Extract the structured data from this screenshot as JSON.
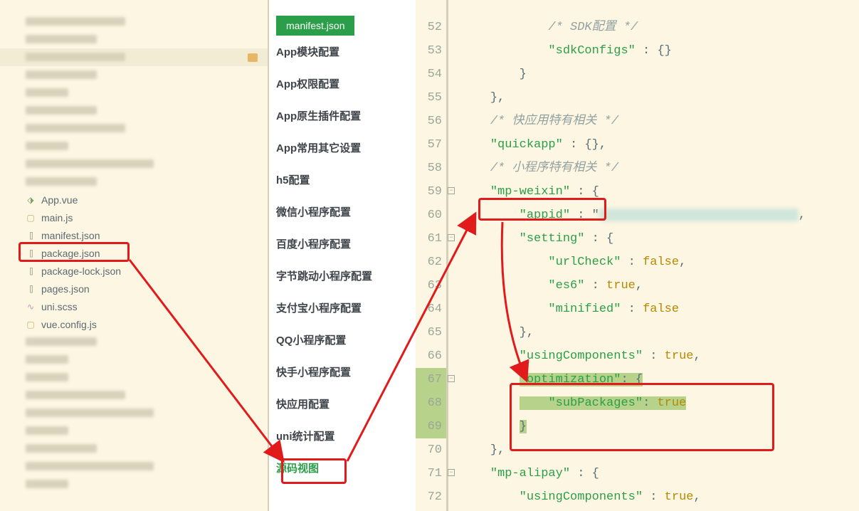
{
  "sidebar": {
    "files": [
      {
        "type": "blur",
        "name": "",
        "w": "w140"
      },
      {
        "type": "blur",
        "name": "",
        "w": "w100"
      },
      {
        "type": "blur",
        "name": "",
        "w": "w140",
        "folder": true
      },
      {
        "type": "blur",
        "name": "",
        "w": "w100"
      },
      {
        "type": "blur",
        "name": "",
        "w": "w60"
      },
      {
        "type": "blur",
        "name": "",
        "w": "w100"
      },
      {
        "type": "blur",
        "name": "",
        "w": "w140"
      },
      {
        "type": "blur",
        "name": "",
        "w": "w60"
      },
      {
        "type": "blur",
        "name": "",
        "w": "w180"
      },
      {
        "type": "blur",
        "name": "",
        "w": "w100"
      },
      {
        "type": "file",
        "name": "App.vue",
        "icon": "vue"
      },
      {
        "type": "file",
        "name": "main.js",
        "icon": "js"
      },
      {
        "type": "file",
        "name": "manifest.json",
        "icon": "json",
        "highlight": true
      },
      {
        "type": "file",
        "name": "package.json",
        "icon": "json"
      },
      {
        "type": "file",
        "name": "package-lock.json",
        "icon": "json"
      },
      {
        "type": "file",
        "name": "pages.json",
        "icon": "json"
      },
      {
        "type": "file",
        "name": "uni.scss",
        "icon": "scss"
      },
      {
        "type": "file",
        "name": "vue.config.js",
        "icon": "js"
      },
      {
        "type": "blur",
        "name": "",
        "w": "w100"
      },
      {
        "type": "blur",
        "name": "",
        "w": "w60"
      },
      {
        "type": "blur",
        "name": "",
        "w": "w60"
      },
      {
        "type": "blur",
        "name": "",
        "w": "w140"
      },
      {
        "type": "blur",
        "name": "",
        "w": "w180"
      },
      {
        "type": "blur",
        "name": "",
        "w": "w60"
      },
      {
        "type": "blur",
        "name": "",
        "w": "w100"
      },
      {
        "type": "blur",
        "name": "",
        "w": "w180"
      },
      {
        "type": "blur",
        "name": "",
        "w": "w60"
      }
    ]
  },
  "confignav": {
    "tab": "manifest.json",
    "items": [
      "App模块配置",
      "App权限配置",
      "App原生插件配置",
      "App常用其它设置",
      "h5配置",
      "微信小程序配置",
      "百度小程序配置",
      "字节跳动小程序配置",
      "支付宝小程序配置",
      "QQ小程序配置",
      "快手小程序配置",
      "快应用配置",
      "uni统计配置",
      "源码视图"
    ],
    "activeIndex": 13
  },
  "code": {
    "startLine": 52,
    "lines": [
      {
        "n": 52,
        "html": "            <span class='c'>/* SDK配置 */</span>"
      },
      {
        "n": 53,
        "html": "            <span class='s'>\"sdkConfigs\"</span> <span class='p'>: {}</span>"
      },
      {
        "n": 54,
        "html": "        <span class='p'>}</span>"
      },
      {
        "n": 55,
        "html": "    <span class='p'>},</span>"
      },
      {
        "n": 56,
        "html": "    <span class='c'>/* 快应用特有相关 */</span>"
      },
      {
        "n": 57,
        "html": "    <span class='s'>\"quickapp\"</span> <span class='p'>: {},</span>"
      },
      {
        "n": 58,
        "html": "    <span class='c'>/* 小程序特有相关 */</span>"
      },
      {
        "n": 59,
        "html": "    <span class='s'>\"mp-weixin\"</span> <span class='p'>: {</span>",
        "fold": true
      },
      {
        "n": 60,
        "html": "        <span class='s'>\"appid\"</span> <span class='p'>: \"</span><span class='blur-inline'></span><span class='p'>,</span>"
      },
      {
        "n": 61,
        "html": "        <span class='s'>\"setting\"</span> <span class='p'>: {</span>",
        "fold": true
      },
      {
        "n": 62,
        "html": "            <span class='s'>\"urlCheck\"</span> <span class='p'>:</span> <span class='b'>false</span><span class='p'>,</span>"
      },
      {
        "n": 63,
        "html": "            <span class='s'>\"es6\"</span> <span class='p'>:</span> <span class='b'>true</span><span class='p'>,</span>"
      },
      {
        "n": 64,
        "html": "            <span class='s'>\"minified\"</span> <span class='p'>:</span> <span class='b'>false</span>"
      },
      {
        "n": 65,
        "html": "        <span class='p'>},</span>"
      },
      {
        "n": 66,
        "html": "        <span class='s'>\"usingComponents\"</span> <span class='p'>:</span> <span class='b'>true</span><span class='p'>,</span>"
      },
      {
        "n": 67,
        "html": "        <span class='hl'><span class='s'>\"optimization\"</span><span class='p'>: {</span></span>",
        "fold": true,
        "hlGutter": true
      },
      {
        "n": 68,
        "html": "        <span class='hl'>    <span class='s'>\"subPackages\"</span><span class='p'>:</span> <span class='b'>true</span></span>",
        "hlGutter": true
      },
      {
        "n": 69,
        "html": "        <span class='hl'><span class='p'>}</span></span>",
        "hlGutter": true
      },
      {
        "n": 70,
        "html": "    <span class='p'>},</span>"
      },
      {
        "n": 71,
        "html": "    <span class='s'>\"mp-alipay\"</span> <span class='p'>: {</span>",
        "fold": true
      },
      {
        "n": 72,
        "html": "        <span class='s'>\"usingComponents\"</span> <span class='p'>:</span> <span class='b'>true</span><span class='p'>,</span>"
      }
    ]
  }
}
